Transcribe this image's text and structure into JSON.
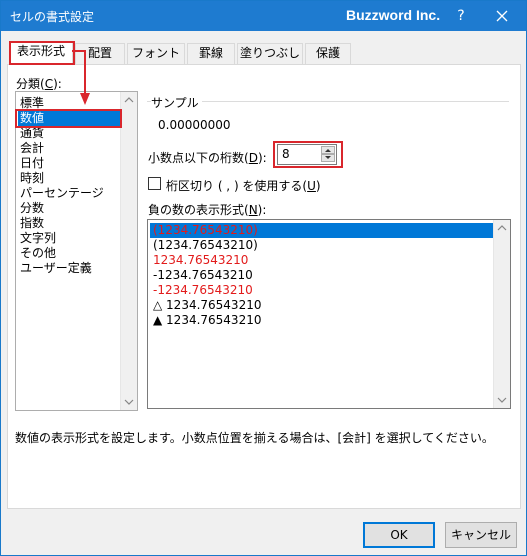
{
  "window": {
    "title": "セルの書式設定",
    "brand": "Buzzword Inc.",
    "help_label": "?",
    "close_icon": "close-icon"
  },
  "tabs": [
    {
      "label": "表示形式",
      "active": true
    },
    {
      "label": "配置",
      "active": false
    },
    {
      "label": "フォント",
      "active": false
    },
    {
      "label": "罫線",
      "active": false
    },
    {
      "label": "塗りつぶし",
      "active": false
    },
    {
      "label": "保護",
      "active": false
    }
  ],
  "category": {
    "label_prefix": "分類(",
    "label_key": "C",
    "label_suffix": "):",
    "items": [
      "標準",
      "数値",
      "通貨",
      "会計",
      "日付",
      "時刻",
      "パーセンテージ",
      "分数",
      "指数",
      "文字列",
      "その他",
      "ユーザー定義"
    ],
    "selected": "数値"
  },
  "sample": {
    "label": "サンプル",
    "value": "0.00000000"
  },
  "decimal": {
    "label_prefix": "小数点以下の桁数(",
    "label_key": "D",
    "label_suffix": "):",
    "value": "8"
  },
  "separator": {
    "label_prefix": "桁区切り ( , ) を使用する(",
    "label_key": "U",
    "label_suffix": ")",
    "checked": false
  },
  "negative": {
    "label_prefix": "負の数の表示形式(",
    "label_key": "N",
    "label_suffix": "):",
    "options": [
      {
        "text": "(1234.76543210)",
        "color": "red",
        "selected": true
      },
      {
        "text": "(1234.76543210)",
        "color": "black",
        "selected": false
      },
      {
        "text": "1234.76543210",
        "color": "red",
        "selected": false
      },
      {
        "text": "-1234.76543210",
        "color": "black",
        "selected": false
      },
      {
        "text": "-1234.76543210",
        "color": "red",
        "selected": false
      },
      {
        "text": "△ 1234.76543210",
        "color": "black",
        "selected": false
      },
      {
        "text": "▲ 1234.76543210",
        "color": "black",
        "selected": false
      }
    ]
  },
  "description": "数値の表示形式を設定します。小数点位置を揃える場合は、[会計] を選択してください。",
  "buttons": {
    "ok": "OK",
    "cancel": "キャンセル"
  },
  "colors": {
    "titlebar": "#1e7bd0",
    "selection": "#0078d7",
    "highlight_box": "#d9262c",
    "negative_red": "#e21b1b"
  }
}
